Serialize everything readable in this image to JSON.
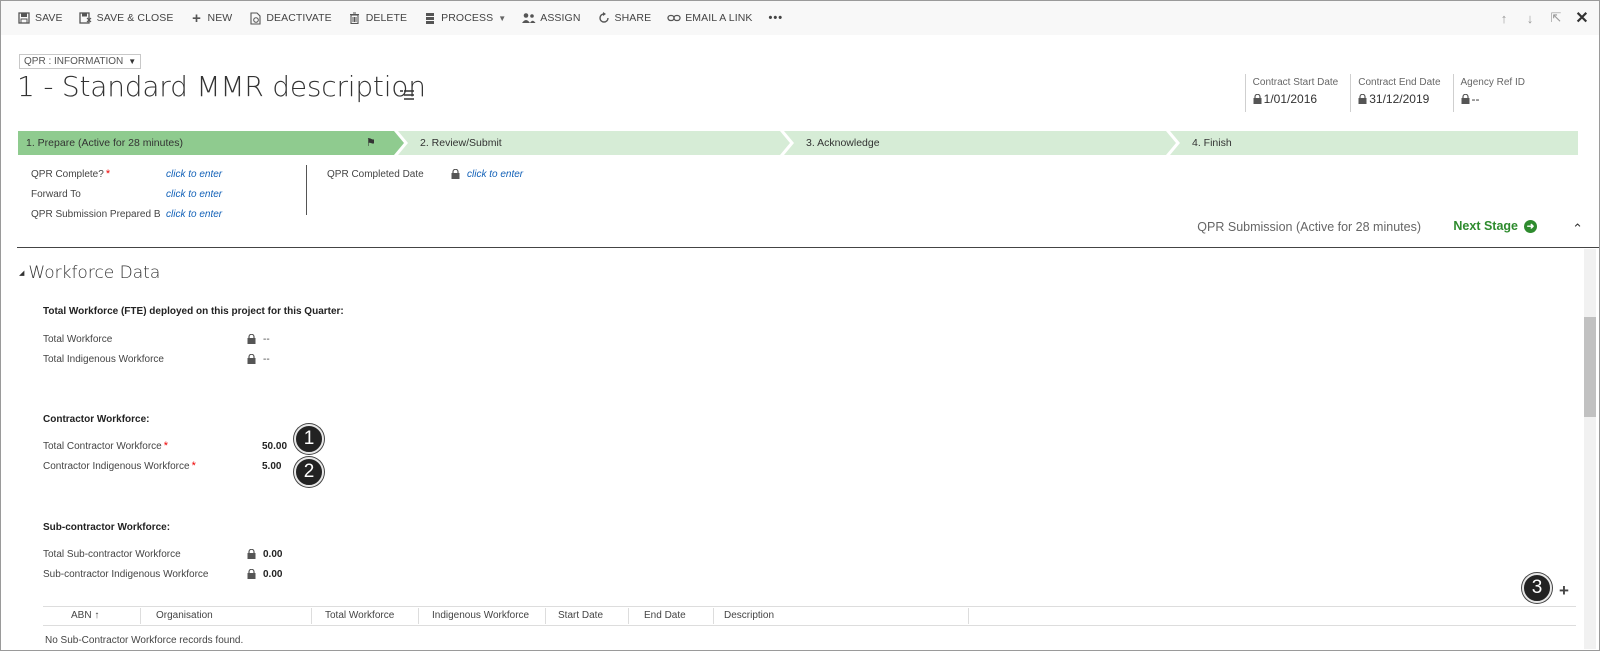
{
  "toolbar": {
    "save": "SAVE",
    "save_close": "SAVE & CLOSE",
    "new": "NEW",
    "deactivate": "DEACTIVATE",
    "delete": "DELETE",
    "process": "PROCESS",
    "assign": "ASSIGN",
    "share": "SHARE",
    "email_link": "EMAIL A LINK",
    "more": "•••"
  },
  "header": {
    "form_selector": "QPR : INFORMATION",
    "title": "1 - Standard MMR description",
    "fields": [
      {
        "label": "Contract Start Date",
        "value": "1/01/2016"
      },
      {
        "label": "Contract End Date",
        "value": "31/12/2019"
      },
      {
        "label": "Agency Ref ID",
        "value": "--"
      }
    ]
  },
  "process": {
    "stages": [
      {
        "label": "1. Prepare (Active for 28 minutes)",
        "active": true
      },
      {
        "label": "2. Review/Submit",
        "active": false
      },
      {
        "label": "3. Acknowledge",
        "active": false
      },
      {
        "label": "4. Finish",
        "active": false
      }
    ],
    "fields": [
      {
        "label": "QPR Complete?",
        "value": "click to enter"
      },
      {
        "label": "Forward To",
        "value": "click to enter"
      },
      {
        "label": "QPR Submission Prepared B",
        "value": "click to enter"
      }
    ],
    "fields_col2": [
      {
        "label": "QPR Completed Date",
        "value": "click to enter"
      }
    ],
    "active_stage_text": "QPR Submission (Active for 28 minutes)",
    "next_stage": "Next Stage"
  },
  "section": {
    "title": "Workforce Data",
    "total_heading": "Total Workforce (FTE) deployed on this project for this Quarter:",
    "total_workforce": {
      "label": "Total Workforce",
      "value": "--"
    },
    "total_indigenous": {
      "label": "Total Indigenous Workforce",
      "value": "--"
    },
    "contractor_heading": "Contractor Workforce:",
    "contractor_total": {
      "label": "Total Contractor Workforce",
      "value": "50.00"
    },
    "contractor_indigenous": {
      "label": "Contractor Indigenous Workforce",
      "value": "5.00"
    },
    "sub_heading": "Sub-contractor Workforce:",
    "sub_total": {
      "label": "Total Sub-contractor Workforce",
      "value": "0.00"
    },
    "sub_indigenous": {
      "label": "Sub-contractor Indigenous Workforce",
      "value": "0.00"
    }
  },
  "callouts": [
    "1",
    "2",
    "3"
  ],
  "grid": {
    "columns": [
      "ABN",
      "Organisation",
      "Total Workforce",
      "Indigenous Workforce",
      "Start Date",
      "End Date",
      "Description"
    ],
    "sort_indicator": "↑",
    "empty_text": "No Sub-Contractor Workforce records found."
  },
  "colors": {
    "active_stage": "#8fcb8f",
    "inactive_stage": "#d6ecd6",
    "next_stage": "#2e8b2e",
    "link": "#1160b7",
    "required": "#ee0000"
  }
}
